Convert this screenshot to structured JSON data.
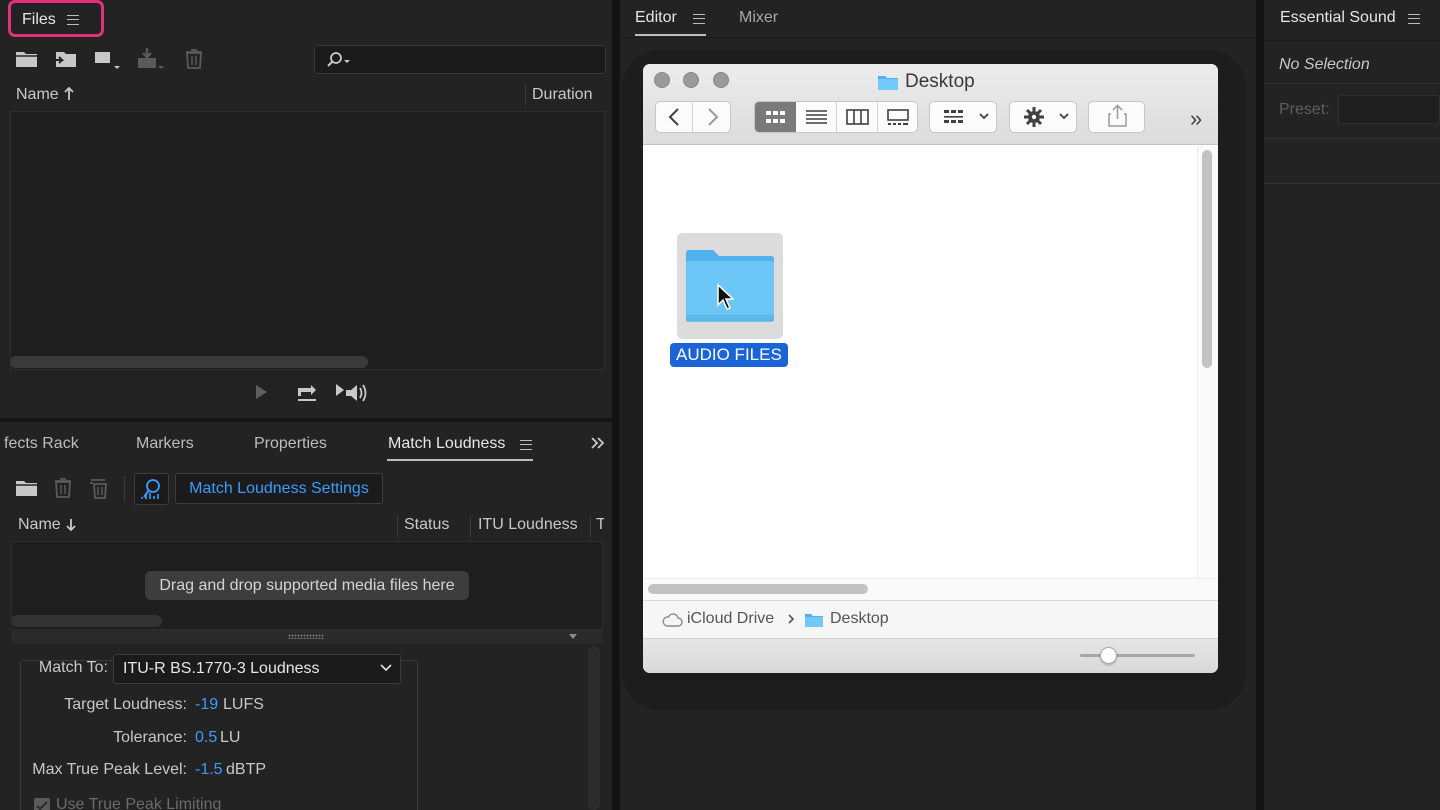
{
  "files_panel": {
    "tab_label": "Files",
    "search": {
      "placeholder": "",
      "value": ""
    },
    "columns": {
      "name": "Name",
      "duration": "Duration"
    },
    "sort_indicator": "arrow-up-icon"
  },
  "lower_panel": {
    "tabs": [
      {
        "label": "fects Rack"
      },
      {
        "label": "Markers"
      },
      {
        "label": "Properties"
      },
      {
        "label": "Match Loudness"
      }
    ],
    "settings_button": "Match Loudness Settings",
    "columns": {
      "name": "Name",
      "status": "Status",
      "itu": "ITU Loudness",
      "truncated": "T"
    },
    "drop_hint": "Drag and drop supported media files here",
    "match_to": {
      "label": "Match To:",
      "value": "ITU-R BS.1770-3 Loudness"
    },
    "target_loudness": {
      "label": "Target Loudness:",
      "value": "-19",
      "unit": "LUFS"
    },
    "tolerance": {
      "label": "Tolerance:",
      "value": "0.5",
      "unit": "LU"
    },
    "max_true_peak": {
      "label": "Max True Peak Level:",
      "value": "-1.5",
      "unit": "dBTP"
    },
    "true_peak_limiting": {
      "label": "Use True Peak Limiting",
      "checked": true
    }
  },
  "editor": {
    "tabs": [
      {
        "label": "Editor"
      },
      {
        "label": "Mixer"
      }
    ]
  },
  "finder": {
    "title": "Desktop",
    "items": [
      {
        "name": "AUDIO FILES",
        "type": "folder",
        "selected": true
      }
    ],
    "path": [
      {
        "label": "iCloud Drive"
      },
      {
        "label": "Desktop"
      }
    ],
    "more_glyph": "»",
    "accent": "#1b64d8",
    "folder_color": "#5fc3f7"
  },
  "essential_sound": {
    "title": "Essential Sound",
    "no_selection": "No Selection",
    "preset_label": "Preset:"
  },
  "colors": {
    "panel_bg": "#232323",
    "accent_blue": "#3a9bff",
    "highlight_border": "#e5307a"
  }
}
